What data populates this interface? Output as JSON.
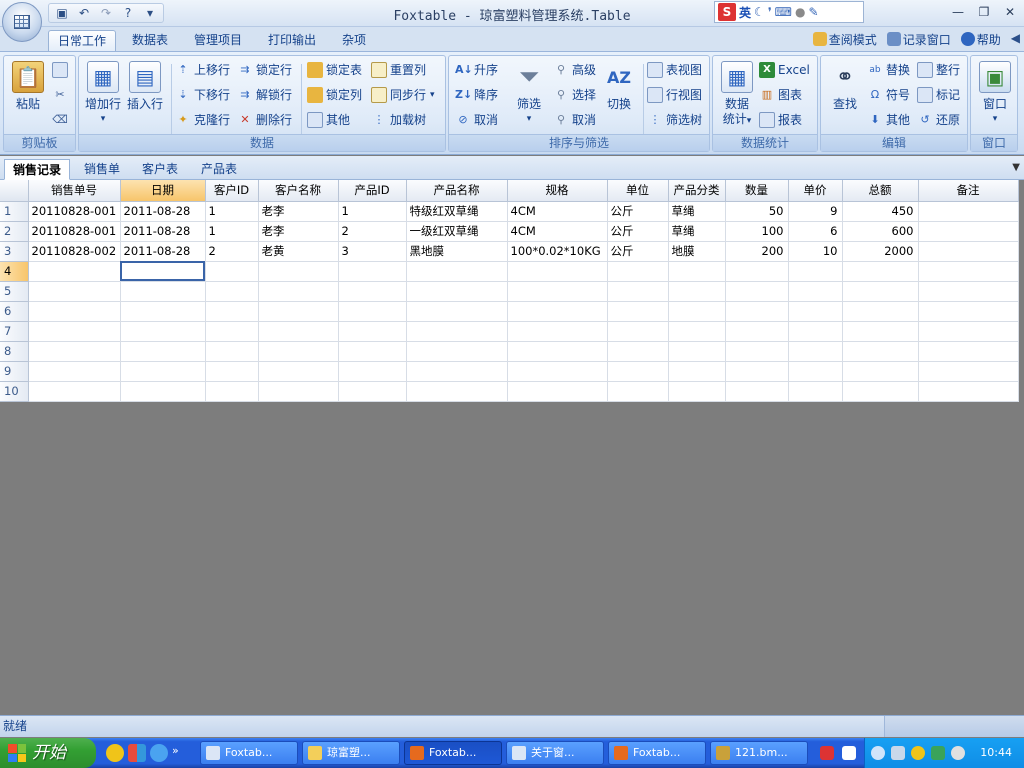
{
  "window": {
    "title": "Foxtable - 琼富塑料管理系统.Table",
    "ime_label": "英",
    "ime_logo": "S",
    "minimize_icon": "minimize-icon",
    "restore_icon": "restore-icon",
    "close_icon": "close-icon"
  },
  "quick_access": {
    "dropdown": "▾"
  },
  "ribbon_tabs": [
    "日常工作",
    "数据表",
    "管理项目",
    "打印输出",
    "杂项"
  ],
  "ribbon_right": {
    "view_mode": "查阅模式",
    "record_window": "记录窗口",
    "help": "帮助"
  },
  "groups": {
    "clipboard": {
      "label": "剪贴板",
      "paste": "粘贴"
    },
    "data": {
      "label": "数据",
      "add_row": "增加行",
      "insert_row": "插入行",
      "move_up": "上移行",
      "move_down": "下移行",
      "clone_row": "克隆行",
      "lock_row": "锁定行",
      "unlock_row": "解锁行",
      "delete_row": "删除行",
      "lock_table": "锁定表",
      "lock_column": "锁定列",
      "other": "其他",
      "reset_column": "重置列",
      "sync_row": "同步行",
      "load_tree": "加载树"
    },
    "sort_filter": {
      "label": "排序与筛选",
      "ascending": "升序",
      "descending": "降序",
      "cancel_sort": "取消",
      "filter": "筛选",
      "advanced": "高级",
      "select": "选择",
      "cancel_filter": "取消",
      "toggle": "切换",
      "table_view": "表视图",
      "row_view": "行视图",
      "filter_tree": "筛选树"
    },
    "statistics": {
      "label": "数据统计",
      "data_stats_1": "数据",
      "data_stats_2": "统计",
      "excel": "Excel",
      "chart": "图表",
      "report": "报表"
    },
    "edit": {
      "label": "编辑",
      "find": "查找",
      "replace": "替换",
      "symbol": "符号",
      "other": "其他",
      "whole_row": "整行",
      "mark": "标记",
      "restore": "还原"
    },
    "window": {
      "label": "窗口",
      "window": "窗口"
    }
  },
  "sheet_tabs": [
    "销售记录",
    "销售单",
    "客户表",
    "产品表"
  ],
  "table": {
    "columns": [
      "销售单号",
      "日期",
      "客户ID",
      "客户名称",
      "产品ID",
      "产品名称",
      "规格",
      "单位",
      "产品分类",
      "数量",
      "单价",
      "总额",
      "备注"
    ],
    "rows": [
      {
        "num": "1",
        "cells": [
          "20110828-001",
          "2011-08-28",
          "1",
          "老李",
          "1",
          "特级红双草绳",
          "4CM",
          "公斤",
          "草绳",
          "50",
          "9",
          "450",
          ""
        ]
      },
      {
        "num": "2",
        "cells": [
          "20110828-001",
          "2011-08-28",
          "1",
          "老李",
          "2",
          "一级红双草绳",
          "4CM",
          "公斤",
          "草绳",
          "100",
          "6",
          "600",
          ""
        ]
      },
      {
        "num": "3",
        "cells": [
          "20110828-002",
          "2011-08-28",
          "2",
          "老黄",
          "3",
          "黑地膜",
          "100*0.02*10KG",
          "公斤",
          "地膜",
          "200",
          "10",
          "2000",
          ""
        ]
      },
      {
        "num": "4",
        "cells": [
          "",
          "",
          "",
          "",
          "",
          "",
          "",
          "",
          "",
          "",
          "",
          "",
          ""
        ]
      },
      {
        "num": "5",
        "cells": [
          "",
          "",
          "",
          "",
          "",
          "",
          "",
          "",
          "",
          "",
          "",
          "",
          ""
        ]
      },
      {
        "num": "6",
        "cells": [
          "",
          "",
          "",
          "",
          "",
          "",
          "",
          "",
          "",
          "",
          "",
          "",
          ""
        ]
      },
      {
        "num": "7",
        "cells": [
          "",
          "",
          "",
          "",
          "",
          "",
          "",
          "",
          "",
          "",
          "",
          "",
          ""
        ]
      },
      {
        "num": "8",
        "cells": [
          "",
          "",
          "",
          "",
          "",
          "",
          "",
          "",
          "",
          "",
          "",
          "",
          ""
        ]
      },
      {
        "num": "9",
        "cells": [
          "",
          "",
          "",
          "",
          "",
          "",
          "",
          "",
          "",
          "",
          "",
          "",
          ""
        ]
      },
      {
        "num": "10",
        "cells": [
          "",
          "",
          "",
          "",
          "",
          "",
          "",
          "",
          "",
          "",
          "",
          "",
          ""
        ]
      }
    ]
  },
  "status": {
    "text": "就绪"
  },
  "taskbar": {
    "start": "开始",
    "items": [
      "Foxtab...",
      "琼富塑...",
      "Foxtab...",
      "关于窗...",
      "Foxtab...",
      "121.bm..."
    ],
    "clock": "10:44"
  },
  "colors": {
    "accent": "#15428b",
    "selected_header": "#f7c56b",
    "taskbar": "#245edb"
  }
}
